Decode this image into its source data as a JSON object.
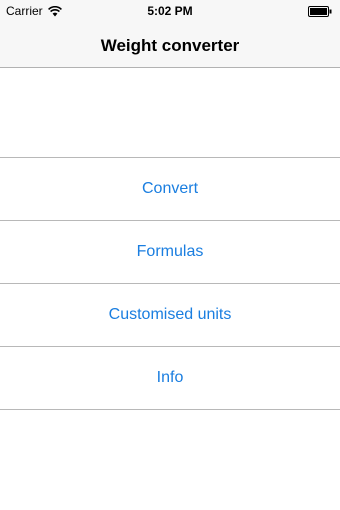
{
  "status_bar": {
    "carrier": "Carrier",
    "time": "5:02 PM"
  },
  "nav": {
    "title": "Weight converter"
  },
  "menu": {
    "items": [
      {
        "label": "Convert"
      },
      {
        "label": "Formulas"
      },
      {
        "label": "Customised units"
      },
      {
        "label": "Info"
      }
    ]
  },
  "colors": {
    "accent": "#1a7ee0",
    "bar_background": "#f7f7f7",
    "separator": "#b8b8b8"
  },
  "icons": [
    "wifi-icon",
    "battery-icon"
  ]
}
